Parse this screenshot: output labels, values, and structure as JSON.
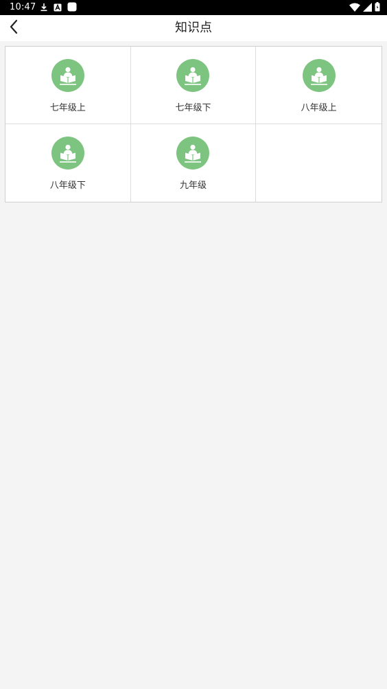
{
  "status_bar": {
    "time": "10:47",
    "left_icons": [
      "download-icon",
      "a-box-icon",
      "app-square-icon"
    ],
    "right_icons": [
      "wifi-icon",
      "signal-icon",
      "battery-icon"
    ]
  },
  "app_bar": {
    "title": "知识点",
    "back_icon": "chevron-left-icon"
  },
  "grid": {
    "items": [
      {
        "label": "七年级上",
        "icon": "reading-person-icon"
      },
      {
        "label": "七年级下",
        "icon": "reading-person-icon"
      },
      {
        "label": "八年级上",
        "icon": "reading-person-icon"
      },
      {
        "label": "八年级下",
        "icon": "reading-person-icon"
      },
      {
        "label": "九年级",
        "icon": "reading-person-icon"
      }
    ]
  },
  "colors": {
    "accent_green": "#7cc47f",
    "background": "#f4f4f4",
    "status_bar": "#000000"
  }
}
